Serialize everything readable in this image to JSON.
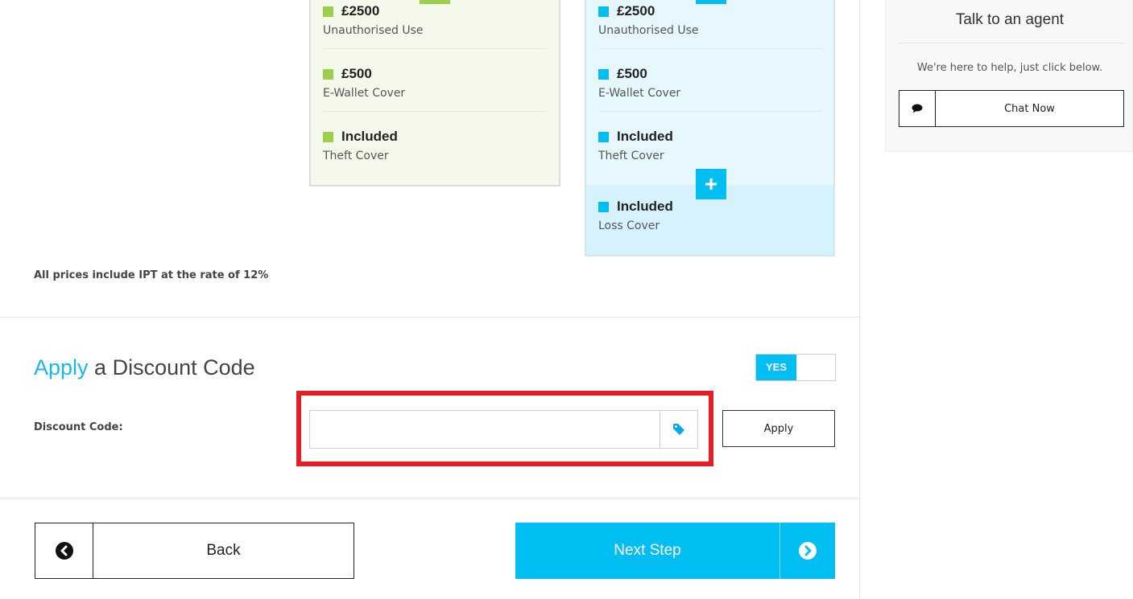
{
  "plans": {
    "green": {
      "features": [
        {
          "value": "£2500",
          "label": "Unauthorised Use"
        },
        {
          "value": "£500",
          "label": "E-Wallet Cover"
        },
        {
          "value": "Included",
          "label": "Theft Cover"
        }
      ]
    },
    "blue": {
      "features": [
        {
          "value": "£2500",
          "label": "Unauthorised Use"
        },
        {
          "value": "£500",
          "label": "E-Wallet Cover"
        },
        {
          "value": "Included",
          "label": "Theft Cover"
        },
        {
          "value": "Included",
          "label": "Loss Cover"
        }
      ],
      "plus_label": "+"
    }
  },
  "ipt_note": "All prices include IPT at the rate of 12%",
  "discount": {
    "title_accent": "Apply",
    "title_rest": " a Discount Code",
    "toggle_label": "YES",
    "code_label": "Discount Code:",
    "code_value": "",
    "code_placeholder": "",
    "apply_label": "Apply"
  },
  "navigation": {
    "back_label": "Back",
    "next_label": "Next Step"
  },
  "agent": {
    "title": "Talk to an agent",
    "help_text": "We're here to help, just click below.",
    "chat_label": "Chat Now"
  },
  "colors": {
    "accent_blue": "#00bdf2",
    "accent_green": "#9bcf4c",
    "highlight_red": "#e41e26"
  },
  "icons": {
    "tag": "tag-icon",
    "back": "chevron-left-circle-icon",
    "next": "chevron-right-circle-icon",
    "chat": "speech-bubble-icon"
  }
}
